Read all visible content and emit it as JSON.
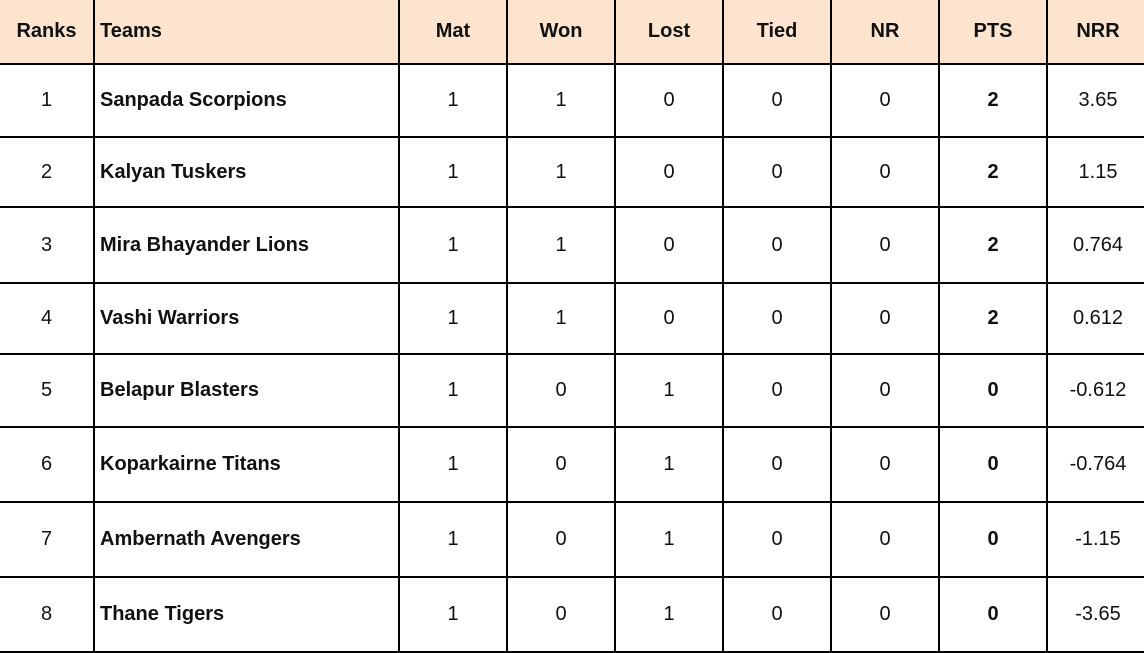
{
  "table": {
    "headers": {
      "rank": "Ranks",
      "team": "Teams",
      "mat": "Mat",
      "won": "Won",
      "lost": "Lost",
      "tied": "Tied",
      "nr": "NR",
      "pts": "PTS",
      "nrr": "NRR"
    },
    "rows": [
      {
        "rank": "1",
        "team": "Sanpada Scorpions",
        "mat": "1",
        "won": "1",
        "lost": "0",
        "tied": "0",
        "nr": "0",
        "pts": "2",
        "nrr": "3.65"
      },
      {
        "rank": "2",
        "team": "Kalyan Tuskers",
        "mat": "1",
        "won": "1",
        "lost": "0",
        "tied": "0",
        "nr": "0",
        "pts": "2",
        "nrr": "1.15"
      },
      {
        "rank": "3",
        "team": "Mira Bhayander Lions",
        "mat": "1",
        "won": "1",
        "lost": "0",
        "tied": "0",
        "nr": "0",
        "pts": "2",
        "nrr": "0.764"
      },
      {
        "rank": "4",
        "team": "Vashi Warriors",
        "mat": "1",
        "won": "1",
        "lost": "0",
        "tied": "0",
        "nr": "0",
        "pts": "2",
        "nrr": "0.612"
      },
      {
        "rank": "5",
        "team": "Belapur Blasters",
        "mat": "1",
        "won": "0",
        "lost": "1",
        "tied": "0",
        "nr": "0",
        "pts": "0",
        "nrr": "-0.612"
      },
      {
        "rank": "6",
        "team": "Koparkairne Titans",
        "mat": "1",
        "won": "0",
        "lost": "1",
        "tied": "0",
        "nr": "0",
        "pts": "0",
        "nrr": "-0.764"
      },
      {
        "rank": "7",
        "team": "Ambernath Avengers",
        "mat": "1",
        "won": "0",
        "lost": "1",
        "tied": "0",
        "nr": "0",
        "pts": "0",
        "nrr": "-1.15"
      },
      {
        "rank": "8",
        "team": "Thane Tigers",
        "mat": "1",
        "won": "0",
        "lost": "1",
        "tied": "0",
        "nr": "0",
        "pts": "0",
        "nrr": "-3.65"
      }
    ]
  },
  "colors": {
    "header_background": "#fce4cf",
    "border": "#000000",
    "text": "#111111"
  }
}
